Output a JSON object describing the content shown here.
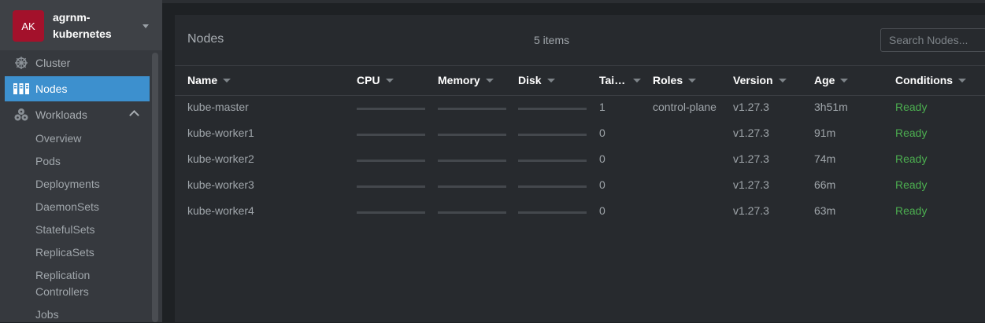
{
  "cluster": {
    "avatar_initials": "AK",
    "name": "agrnm-kubernetes",
    "name_line1": "agrnm-",
    "name_line2": "kubernetes"
  },
  "sidebar": {
    "items": [
      {
        "label": "Cluster",
        "icon": "helm-wheel-icon"
      },
      {
        "label": "Nodes",
        "icon": "nodes-icon",
        "active": true
      },
      {
        "label": "Workloads",
        "icon": "workloads-icon",
        "expanded": true
      }
    ],
    "workloads_sub": [
      "Overview",
      "Pods",
      "Deployments",
      "DaemonSets",
      "StatefulSets",
      "ReplicaSets",
      "Replication",
      "Controllers",
      "Jobs"
    ]
  },
  "panel": {
    "title": "Nodes",
    "count": "5 items",
    "search_placeholder": "Search Nodes..."
  },
  "table": {
    "columns": [
      "Name",
      "CPU",
      "Memory",
      "Disk",
      "Tai…",
      "Roles",
      "Version",
      "Age",
      "Conditions"
    ],
    "rows": [
      {
        "name": "kube-master",
        "taints": "1",
        "roles": "control-plane",
        "version": "v1.27.3",
        "age": "3h51m",
        "conditions": "Ready"
      },
      {
        "name": "kube-worker1",
        "taints": "0",
        "roles": "",
        "version": "v1.27.3",
        "age": "91m",
        "conditions": "Ready"
      },
      {
        "name": "kube-worker2",
        "taints": "0",
        "roles": "",
        "version": "v1.27.3",
        "age": "74m",
        "conditions": "Ready"
      },
      {
        "name": "kube-worker3",
        "taints": "0",
        "roles": "",
        "version": "v1.27.3",
        "age": "66m",
        "conditions": "Ready"
      },
      {
        "name": "kube-worker4",
        "taints": "0",
        "roles": "",
        "version": "v1.27.3",
        "age": "63m",
        "conditions": "Ready"
      }
    ]
  },
  "colors": {
    "accent": "#3d90ce",
    "ready": "#4caf50",
    "avatar": "#a3112b"
  }
}
